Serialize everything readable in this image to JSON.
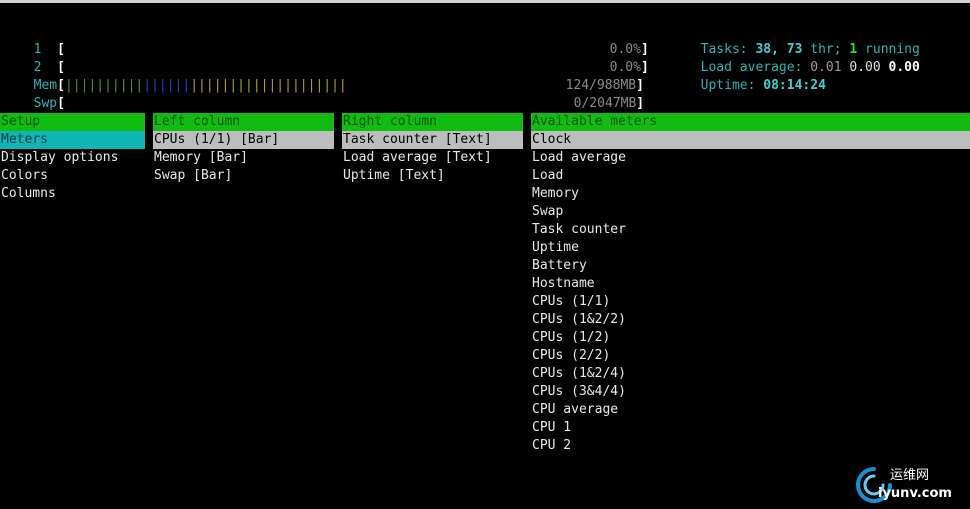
{
  "meters": {
    "cpu1": {
      "label": "1",
      "open": "[",
      "value": "0.0%",
      "close": "]"
    },
    "cpu2": {
      "label": "2",
      "open": "[",
      "value": "0.0%",
      "close": "]"
    },
    "mem": {
      "label": "Mem",
      "open": "[",
      "value": "124/988MB",
      "close": "]",
      "bar_green": "||||||||||",
      "bar_blue": "||||||",
      "bar_yellow": "||||||||||||||||||||"
    },
    "swp": {
      "label": "Swp",
      "open": "[",
      "value": "0/2047MB",
      "close": "]"
    }
  },
  "stats": {
    "tasks_label": "Tasks: ",
    "tasks_value": "38",
    "tasks_sep": ", ",
    "threads_value": "73",
    "threads_label": " thr; ",
    "running_value": "1",
    "running_label": " running",
    "load_label": "Load average: ",
    "load1": "0.01",
    "load5": "0.00",
    "load15": "0.00",
    "uptime_label": "Uptime: ",
    "uptime_value": "08:14:24"
  },
  "setup": {
    "header": "Setup",
    "items": [
      "Meters",
      "Display options",
      "Colors",
      "Columns"
    ],
    "selected_index": 0
  },
  "left_column": {
    "header": "Left column",
    "items": [
      "CPUs (1/1) [Bar]",
      "Memory [Bar]",
      "Swap [Bar]"
    ],
    "selected_index": 0
  },
  "right_column": {
    "header": "Right column",
    "items": [
      "Task counter [Text]",
      "Load average [Text]",
      "Uptime [Text]"
    ],
    "selected_index": 0
  },
  "available_meters": {
    "header": "Available meters",
    "items": [
      "Clock",
      "Load average",
      "Load",
      "Memory",
      "Swap",
      "Task counter",
      "Uptime",
      "Battery",
      "Hostname",
      "CPUs (1/1)",
      "CPUs (1&2/2)",
      "CPUs (1/2)",
      "CPUs (2/2)",
      "CPUs (1&2/4)",
      "CPUs (3&4/4)",
      "CPU average",
      "CPU 1",
      "CPU 2"
    ],
    "selected_index": 0
  },
  "watermark": {
    "line1": "运维网",
    "line2": "iyunv.com"
  },
  "colors": {
    "header_green": "#11bb11",
    "select_cyan": "#11b5b5",
    "select_gray": "#bdbdbd",
    "label_cyan": "#2fb3b3"
  }
}
